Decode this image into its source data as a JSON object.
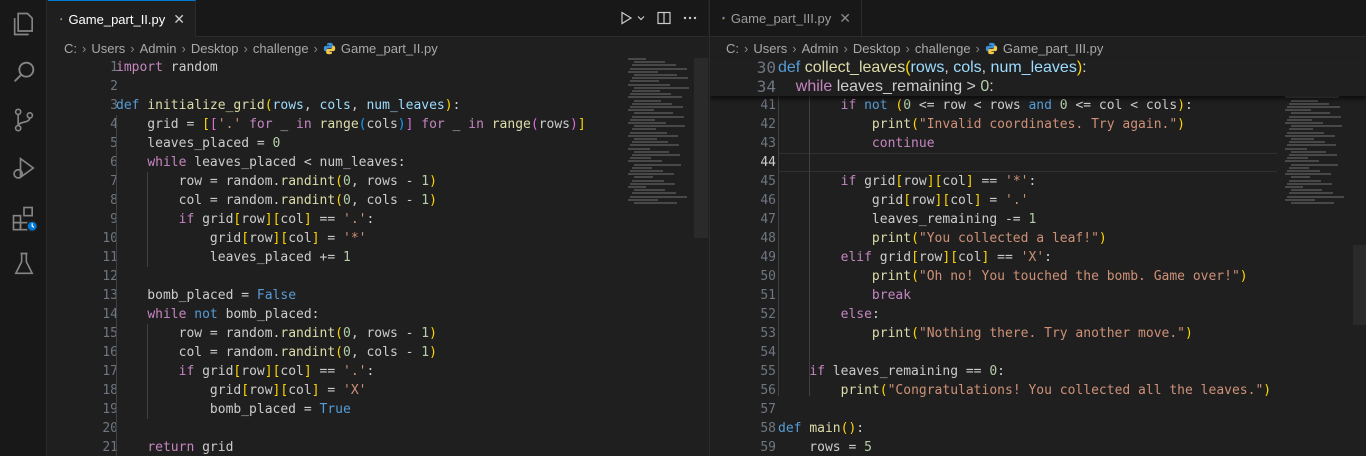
{
  "activity_bar": {
    "items": [
      {
        "name": "explorer-icon"
      },
      {
        "name": "search-icon"
      },
      {
        "name": "source-control-icon"
      },
      {
        "name": "run-debug-icon"
      },
      {
        "name": "extensions-icon"
      },
      {
        "name": "testing-icon"
      }
    ]
  },
  "left": {
    "tab": {
      "label": "Game_part_II.py",
      "close": "✕"
    },
    "breadcrumb": [
      "C:",
      "Users",
      "Admin",
      "Desktop",
      "challenge",
      "Game_part_II.py"
    ],
    "lines": [
      {
        "n": "1",
        "html": "<span class='kc'>import</span> random"
      },
      {
        "n": "2",
        "html": ""
      },
      {
        "n": "3",
        "html": "<span class='kw'>def</span> <span class='fn'>initialize_grid</span><span class='b1'>(</span><span class='pm'>rows</span>, <span class='pm'>cols</span>, <span class='pm'>num_leaves</span><span class='b1'>)</span>:"
      },
      {
        "n": "4",
        "html": "    grid = <span class='b1'>[</span><span class='b2'>[</span><span class='st'>'.'</span> <span class='kc'>for</span> _ <span class='kc'>in</span> <span class='fn'>range</span><span class='b3'>(</span>cols<span class='b3'>)</span><span class='b2'>]</span> <span class='kc'>for</span> _ <span class='kc'>in</span> <span class='fn'>range</span><span class='b2'>(</span>rows<span class='b2'>)</span><span class='b1'>]</span>"
      },
      {
        "n": "5",
        "html": "    leaves_placed = <span class='nm'>0</span>"
      },
      {
        "n": "6",
        "html": "    <span class='kc'>while</span> leaves_placed &lt; num_leaves:"
      },
      {
        "n": "7",
        "html": "        row = random.<span class='fn'>randint</span><span class='b1'>(</span><span class='nm'>0</span>, rows - <span class='nm'>1</span><span class='b1'>)</span>"
      },
      {
        "n": "8",
        "html": "        col = random.<span class='fn'>randint</span><span class='b1'>(</span><span class='nm'>0</span>, cols - <span class='nm'>1</span><span class='b1'>)</span>"
      },
      {
        "n": "9",
        "html": "        <span class='kc'>if</span> grid<span class='b1'>[</span>row<span class='b1'>]</span><span class='b1'>[</span>col<span class='b1'>]</span> == <span class='st'>'.'</span>:"
      },
      {
        "n": "10",
        "html": "            grid<span class='b1'>[</span>row<span class='b1'>]</span><span class='b1'>[</span>col<span class='b1'>]</span> = <span class='st'>'*'</span>"
      },
      {
        "n": "11",
        "html": "            leaves_placed += <span class='nm'>1</span>"
      },
      {
        "n": "12",
        "html": ""
      },
      {
        "n": "13",
        "html": "    bomb_placed = <span class='kw'>False</span>"
      },
      {
        "n": "14",
        "html": "    <span class='kc'>while</span> <span class='kw'>not</span> bomb_placed:"
      },
      {
        "n": "15",
        "html": "        row = random.<span class='fn'>randint</span><span class='b1'>(</span><span class='nm'>0</span>, rows - <span class='nm'>1</span><span class='b1'>)</span>"
      },
      {
        "n": "16",
        "html": "        col = random.<span class='fn'>randint</span><span class='b1'>(</span><span class='nm'>0</span>, cols - <span class='nm'>1</span><span class='b1'>)</span>"
      },
      {
        "n": "17",
        "html": "        <span class='kc'>if</span> grid<span class='b1'>[</span>row<span class='b1'>]</span><span class='b1'>[</span>col<span class='b1'>]</span> == <span class='st'>'.'</span>:"
      },
      {
        "n": "18",
        "html": "            grid<span class='b1'>[</span>row<span class='b1'>]</span><span class='b1'>[</span>col<span class='b1'>]</span> = <span class='st'>'X'</span>"
      },
      {
        "n": "19",
        "html": "            bomb_placed = <span class='kw'>True</span>"
      },
      {
        "n": "20",
        "html": ""
      },
      {
        "n": "21",
        "html": "    <span class='kc'>return</span> grid"
      }
    ]
  },
  "right": {
    "tab": {
      "label": "Game_part_III.py",
      "close": "✕"
    },
    "breadcrumb": [
      "C:",
      "Users",
      "Admin",
      "Desktop",
      "challenge",
      "Game_part_III.py"
    ],
    "sticky": [
      {
        "n": "30",
        "html": "<span class='kw'>def</span> <span class='fn'>collect_leaves</span><span class='b1'>(</span><span class='pm'>rows</span>, <span class='pm'>cols</span>, <span class='pm'>num_leaves</span><span class='b1'>)</span>:"
      },
      {
        "n": "34",
        "html": "    <span class='kc'>while</span> leaves_remaining &gt; <span class='nm'>0</span>:"
      }
    ],
    "lines": [
      {
        "n": "41",
        "html": "        <span class='kc'>if</span> <span class='kw'>not</span> <span class='b1'>(</span><span class='nm'>0</span> &lt;= row &lt; rows <span class='kw'>and</span> <span class='nm'>0</span> &lt;= col &lt; cols<span class='b1'>)</span>:"
      },
      {
        "n": "42",
        "html": "            <span class='fn'>print</span><span class='b1'>(</span><span class='st'>\"Invalid coordinates. Try again.\"</span><span class='b1'>)</span>"
      },
      {
        "n": "43",
        "html": "            <span class='kc'>continue</span>"
      },
      {
        "n": "44",
        "html": "",
        "current": true
      },
      {
        "n": "45",
        "html": "        <span class='kc'>if</span> grid<span class='b1'>[</span>row<span class='b1'>]</span><span class='b1'>[</span>col<span class='b1'>]</span> == <span class='st'>'*'</span>:"
      },
      {
        "n": "46",
        "html": "            grid<span class='b1'>[</span>row<span class='b1'>]</span><span class='b1'>[</span>col<span class='b1'>]</span> = <span class='st'>'.'</span>"
      },
      {
        "n": "47",
        "html": "            leaves_remaining -= <span class='nm'>1</span>"
      },
      {
        "n": "48",
        "html": "            <span class='fn'>print</span><span class='b1'>(</span><span class='st'>\"You collected a leaf!\"</span><span class='b1'>)</span>"
      },
      {
        "n": "49",
        "html": "        <span class='kc'>elif</span> grid<span class='b1'>[</span>row<span class='b1'>]</span><span class='b1'>[</span>col<span class='b1'>]</span> == <span class='st'>'X'</span>:"
      },
      {
        "n": "50",
        "html": "            <span class='fn'>print</span><span class='b1'>(</span><span class='st'>\"Oh no! You touched the bomb. Game over!\"</span><span class='b1'>)</span>"
      },
      {
        "n": "51",
        "html": "            <span class='kc'>break</span>"
      },
      {
        "n": "52",
        "html": "        <span class='kc'>else</span>:"
      },
      {
        "n": "53",
        "html": "            <span class='fn'>print</span><span class='b1'>(</span><span class='st'>\"Nothing there. Try another move.\"</span><span class='b1'>)</span>"
      },
      {
        "n": "54",
        "html": ""
      },
      {
        "n": "55",
        "html": "    <span class='kc'>if</span> leaves_remaining == <span class='nm'>0</span>:"
      },
      {
        "n": "56",
        "html": "        <span class='fn'>print</span><span class='b1'>(</span><span class='st'>\"Congratulations! You collected all the leaves.\"</span><span class='b1'>)</span>"
      },
      {
        "n": "57",
        "html": ""
      },
      {
        "n": "58",
        "html": "<span class='kw'>def</span> <span class='fn'>main</span><span class='b1'>()</span>:"
      },
      {
        "n": "59",
        "html": "    rows = <span class='nm'>5</span>"
      }
    ]
  }
}
